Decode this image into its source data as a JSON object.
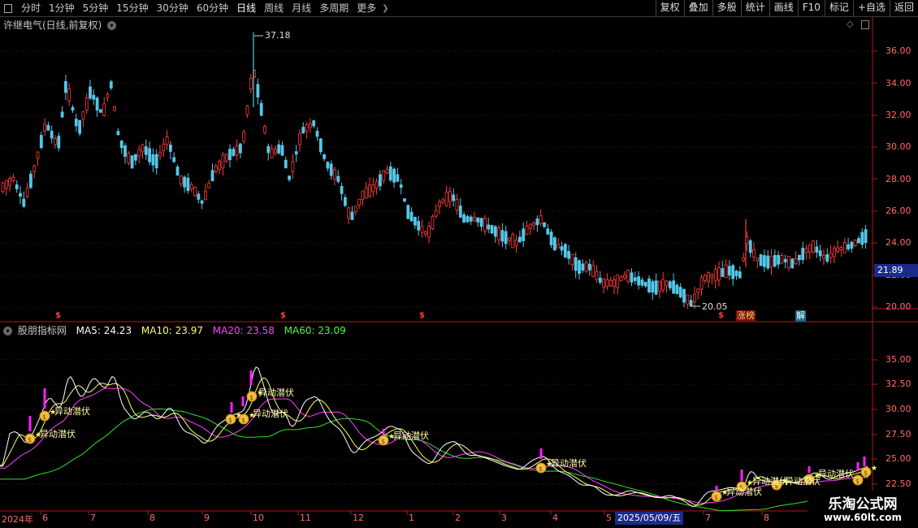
{
  "toolbar": {
    "left_items": [
      {
        "label": "分时"
      },
      {
        "label": "1分钟"
      },
      {
        "label": "5分钟"
      },
      {
        "label": "15分钟"
      },
      {
        "label": "30分钟"
      },
      {
        "label": "60分钟"
      },
      {
        "label": "日线",
        "active": true
      },
      {
        "label": "周线"
      },
      {
        "label": "月线"
      },
      {
        "label": "多周期"
      },
      {
        "label": "更多"
      }
    ],
    "right_buttons": [
      "复权",
      "叠加",
      "多股",
      "统计",
      "画线",
      "F10",
      "标记",
      "+自选",
      "返回"
    ]
  },
  "price_panel": {
    "title": "许继电气(日线,前复权)",
    "high_label": "37.18",
    "low_label": "20.05",
    "current_price": "21.89",
    "event_marks": [
      "涨",
      "榜",
      "解"
    ],
    "y_ticks": [
      "36.00",
      "34.00",
      "32.00",
      "30.00",
      "28.00",
      "26.00",
      "24.00",
      "22.00",
      "20.00"
    ]
  },
  "indicator_panel": {
    "name": "股朋指标网",
    "ma": [
      {
        "label": "MA5: 24.23",
        "color": "#ffffff"
      },
      {
        "label": "MA10: 23.97",
        "color": "#ffff66"
      },
      {
        "label": "MA20: 23.58",
        "color": "#ff40ff"
      },
      {
        "label": "MA60: 23.09",
        "color": "#40ff40"
      }
    ],
    "y_ticks": [
      "35.00",
      "32.50",
      "30.00",
      "27.50",
      "25.00",
      "22.50"
    ],
    "signal_text": "异动潜伏"
  },
  "x_axis": {
    "labels": [
      "2024年",
      "6",
      "7",
      "8",
      "9",
      "10",
      "11",
      "12",
      "1",
      "2",
      "3",
      "4",
      "5",
      "7",
      "8"
    ],
    "cursor_date": "2025/05/09/五"
  },
  "watermark": {
    "title": "乐淘公式网",
    "url": "www.60lt.com"
  },
  "colors": {
    "up": "#ff3b3b",
    "down": "#54c7e8",
    "axis": "#b01818"
  }
}
